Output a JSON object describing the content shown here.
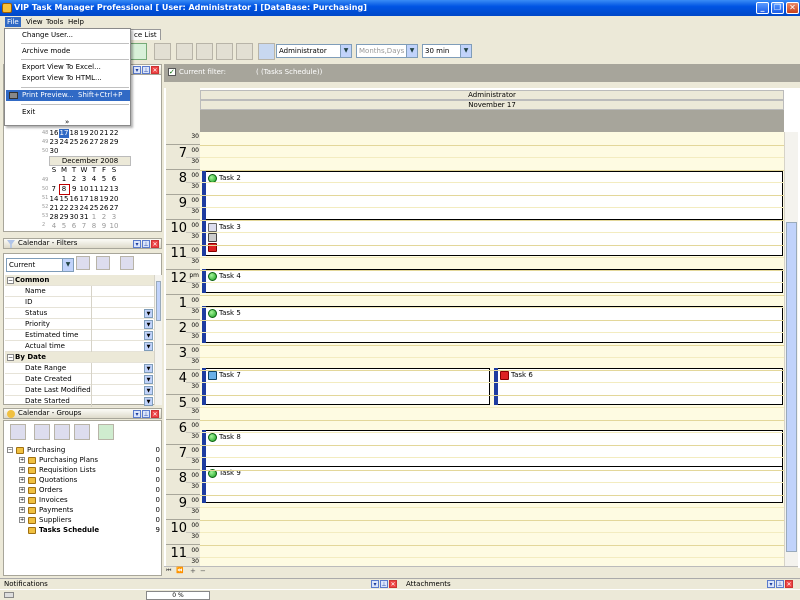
{
  "window": {
    "title": "VIP Task Manager Professional [ User: Administrator ] [DataBase: Purchasing]"
  },
  "menubar": {
    "file": "File",
    "view": "View",
    "tools": "Tools",
    "help": "Help"
  },
  "file_menu": {
    "change_user": "Change User...",
    "archive_mode": "Archive mode",
    "export_excel": "Export View To Excel...",
    "export_html": "Export View To HTML...",
    "print_preview": "Print Preview...",
    "print_preview_shortcut": "Shift+Ctrl+P",
    "exit": "Exit",
    "more": "»"
  },
  "tabs": {
    "service_list": "ce List"
  },
  "toolbar": {
    "user_combo": "Administrator",
    "view_combo": "Months,Days",
    "interval_combo": "30 min"
  },
  "calendar_nav": {
    "nov_rows": [
      [
        "16",
        "17",
        "18",
        "19",
        "20",
        "21",
        "22"
      ],
      [
        "23",
        "24",
        "25",
        "26",
        "27",
        "28",
        "29"
      ],
      [
        "30",
        "",
        "",
        "",
        "",
        "",
        ""
      ]
    ],
    "nov_weeks": [
      "48",
      "49",
      "50"
    ],
    "dec_title": "December 2008",
    "weekdays": [
      "S",
      "M",
      "T",
      "W",
      "T",
      "F",
      "S"
    ],
    "dec_rows": [
      [
        "",
        "1",
        "2",
        "3",
        "4",
        "5",
        "6"
      ],
      [
        "7",
        "8",
        "9",
        "10",
        "11",
        "12",
        "13"
      ],
      [
        "14",
        "15",
        "16",
        "17",
        "18",
        "19",
        "20"
      ],
      [
        "21",
        "22",
        "23",
        "24",
        "25",
        "26",
        "27"
      ],
      [
        "28",
        "29",
        "30",
        "31",
        "1",
        "2",
        "3"
      ],
      [
        "4",
        "5",
        "6",
        "7",
        "8",
        "9",
        "10"
      ]
    ],
    "dec_weeks": [
      "49",
      "50",
      "51",
      "52",
      "53",
      "2"
    ]
  },
  "filters": {
    "title": "Calendar - Filters",
    "combo": "Current",
    "cat_common": "Common",
    "cat_bydate": "By Date",
    "common_props": [
      "Name",
      "ID",
      "Status",
      "Priority",
      "Estimated time",
      "Actual time"
    ],
    "date_props": [
      "Date Range",
      "Date Created",
      "Date Last Modified",
      "Date Started"
    ]
  },
  "groups": {
    "title": "Calendar - Groups",
    "root": "Purchasing",
    "root_count": "0",
    "items": [
      {
        "label": "Purchasing Plans",
        "count": "0"
      },
      {
        "label": "Requisition Lists",
        "count": "0"
      },
      {
        "label": "Quotations",
        "count": "0"
      },
      {
        "label": "Orders",
        "count": "0"
      },
      {
        "label": "Invoices",
        "count": "0"
      },
      {
        "label": "Payments",
        "count": "0"
      },
      {
        "label": "Suppliers",
        "count": "0"
      }
    ],
    "schedule": "Tasks Schedule",
    "schedule_count": "9"
  },
  "schedule": {
    "current_filter_label": "Current filter:",
    "current_filter_value": "( (Tasks Schedule))",
    "resource": "Administrator",
    "date": "November 17",
    "hours": [
      {
        "h": "7",
        "m": "00"
      },
      {
        "h": "8",
        "m": "00"
      },
      {
        "h": "9",
        "m": "00"
      },
      {
        "h": "10",
        "m": "00"
      },
      {
        "h": "11",
        "m": "00"
      },
      {
        "h": "12",
        "m": "pm"
      },
      {
        "h": "1",
        "m": "00"
      },
      {
        "h": "2",
        "m": "00"
      },
      {
        "h": "3",
        "m": "00"
      },
      {
        "h": "4",
        "m": "00"
      },
      {
        "h": "5",
        "m": "00"
      },
      {
        "h": "6",
        "m": "00"
      },
      {
        "h": "7",
        "m": "00"
      },
      {
        "h": "8",
        "m": "00"
      },
      {
        "h": "9",
        "m": "00"
      },
      {
        "h": "10",
        "m": "00"
      },
      {
        "h": "11",
        "m": "00"
      }
    ],
    "half": "30",
    "tasks": {
      "task2": "Task 2",
      "task3": "Task 3",
      "task4": "Task 4",
      "task5": "Task 5",
      "task6": "Task 6",
      "task7": "Task 7",
      "task8": "Task 8",
      "task9": "Task 9"
    }
  },
  "bottom": {
    "notifications": "Notifications",
    "attachments": "Attachments",
    "progress": "0 %"
  }
}
